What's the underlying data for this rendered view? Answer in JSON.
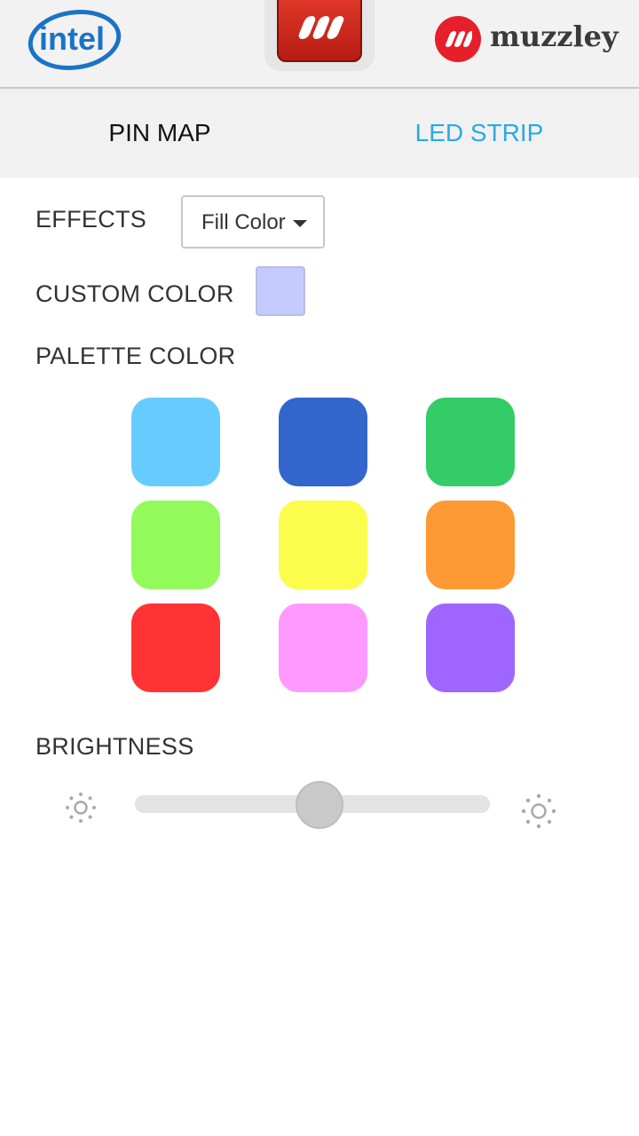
{
  "header": {
    "left_logo": "intel",
    "center_app_icon": "muzzley-app-icon",
    "right_logo": {
      "wordmark": "muzzley"
    }
  },
  "tabs": [
    {
      "label": "PIN MAP",
      "active": false
    },
    {
      "label": "LED STRIP",
      "active": true
    }
  ],
  "effects": {
    "label": "EFFECTS",
    "selected": "Fill Color"
  },
  "custom_color": {
    "label": "CUSTOM COLOR",
    "value": "#c3cbff"
  },
  "palette": {
    "label": "PALETTE COLOR",
    "colors": [
      "#66ccff",
      "#3366cc",
      "#33cc66",
      "#93fa5c",
      "#fcfc4d",
      "#ff9933",
      "#ff3333",
      "#ff99ff",
      "#9f66ff"
    ]
  },
  "brightness": {
    "label": "BRIGHTNESS",
    "value_fraction": 0.52,
    "min_icon": "sun-small-icon",
    "max_icon": "sun-large-icon"
  },
  "colors": {
    "accent_tab": "#29abe2",
    "muzzley_red": "#e5202a"
  }
}
